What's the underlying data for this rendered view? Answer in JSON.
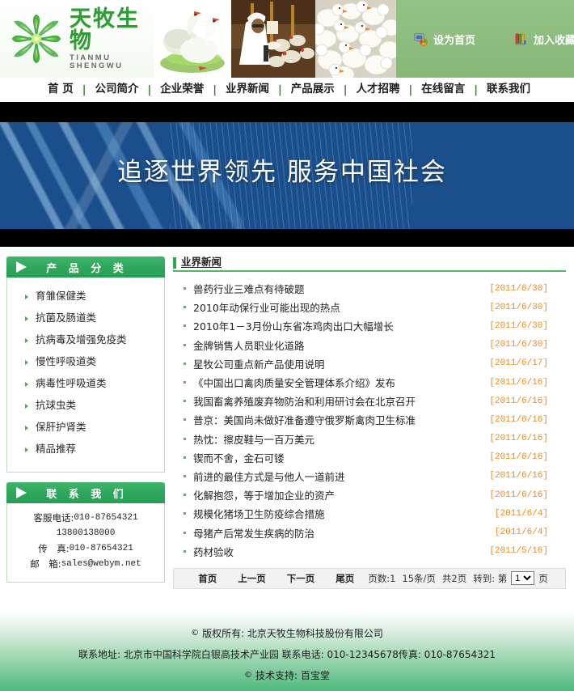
{
  "header": {
    "logo": {
      "cn": "天牧生物",
      "en": "TIANMU SHENGWU",
      "icon": "flower-pinwheel-icon"
    },
    "photos": [
      {
        "name": "geese-photo",
        "alt": "白鹅"
      },
      {
        "name": "worker-poultry-photo",
        "alt": "工人与鸡"
      },
      {
        "name": "chicks-photo",
        "alt": "雏鸡群"
      }
    ],
    "links": [
      {
        "label": "设为首页",
        "icon": "set-homepage-icon"
      },
      {
        "label": "加入收藏",
        "icon": "add-favorite-icon"
      }
    ]
  },
  "nav": {
    "separator": "|",
    "items": [
      {
        "label": "首 页"
      },
      {
        "label": "公司简介"
      },
      {
        "label": "企业荣誉"
      },
      {
        "label": "业界新闻"
      },
      {
        "label": "产品展示"
      },
      {
        "label": "人才招聘"
      },
      {
        "label": "在线留言"
      },
      {
        "label": "联系我们"
      }
    ]
  },
  "banner": {
    "slogan": "追逐世界领先  服务中国社会"
  },
  "sidebar": {
    "products": {
      "title": "产 品 分 类",
      "arrow_icon": "triangle-right-icon",
      "items": [
        {
          "label": "育雏保健类"
        },
        {
          "label": "抗菌及肠道类"
        },
        {
          "label": "抗病毒及增强免疫类"
        },
        {
          "label": "慢性呼吸道类"
        },
        {
          "label": "病毒性呼吸道类"
        },
        {
          "label": "抗球虫类"
        },
        {
          "label": "保肝护肾类"
        },
        {
          "label": "精品推荐"
        }
      ]
    },
    "contact": {
      "title": "联 系 我 们",
      "arrow_icon": "triangle-right-icon",
      "rows": [
        {
          "label": "客服电话:",
          "value": "010-87654321"
        },
        {
          "label": "",
          "value": "13800138000"
        },
        {
          "label": "传　真:",
          "value": "010-87654321"
        },
        {
          "label": "邮　箱:",
          "value": "sales@webym.net"
        }
      ]
    }
  },
  "main": {
    "section_title": "业界新闻",
    "news": [
      {
        "title": "兽药行业三难点有待破题",
        "date": "[2011/6/30]"
      },
      {
        "title": "2010年动保行业可能出现的热点",
        "date": "[2011/6/30]"
      },
      {
        "title": "2010年1－3月份山东省冻鸡肉出口大幅增长",
        "date": "[2011/6/30]"
      },
      {
        "title": "金牌销售人员职业化道路",
        "date": "[2011/6/30]"
      },
      {
        "title": "星牧公司重点新产品使用说明",
        "date": "[2011/6/17]"
      },
      {
        "title": "《中国出口禽肉质量安全管理体系介绍》发布",
        "date": "[2011/6/16]"
      },
      {
        "title": "我国畜禽养殖废弃物防治和利用研讨会在北京召开",
        "date": "[2011/6/16]"
      },
      {
        "title": "普京：美国尚未做好准备遵守俄罗斯禽肉卫生标准",
        "date": "[2011/6/16]"
      },
      {
        "title": "热忱：擦皮鞋与一百万美元",
        "date": "[2011/6/16]"
      },
      {
        "title": "锲而不舍，金石可镂",
        "date": "[2011/6/16]"
      },
      {
        "title": "前进的最佳方式是与他人一道前进",
        "date": "[2011/6/16]"
      },
      {
        "title": "化解抱怨，等于增加企业的资产",
        "date": "[2011/6/16]"
      },
      {
        "title": "规模化猪场卫生防疫综合措施",
        "date": "[2011/6/4]"
      },
      {
        "title": "母猪产后常发生疾病的防治",
        "date": "[2011/6/4]"
      },
      {
        "title": "药材验收",
        "date": "[2011/5/16]"
      }
    ],
    "pager": {
      "first": "首页",
      "prev": "上一页",
      "next": "下一页",
      "last": "尾页",
      "page_info": "页数:1",
      "per_page": "15条/页",
      "total": "共2页",
      "goto_prefix": "转到: 第",
      "goto_suffix": "页",
      "selected_page": "1",
      "page_options": [
        "1",
        "2"
      ]
    }
  },
  "footer": {
    "copyright_mark": "©",
    "copyright": "版权所有: 北京天牧生物科技股份有限公司",
    "address_line": "联系地址: 北京市中国科学院白银高技术产业园  联系电话: 010-12345678传真: 010-87654321",
    "support_mark": "©",
    "support_label": "技术支持:",
    "support_name": "百宝堂"
  },
  "colors": {
    "brand_green": "#2fa75c",
    "nav_text": "#1e1e1e",
    "date_orange": "#f08a1c",
    "banner_blue": "#1b4f8c",
    "header_green": "#8bbd7d"
  }
}
